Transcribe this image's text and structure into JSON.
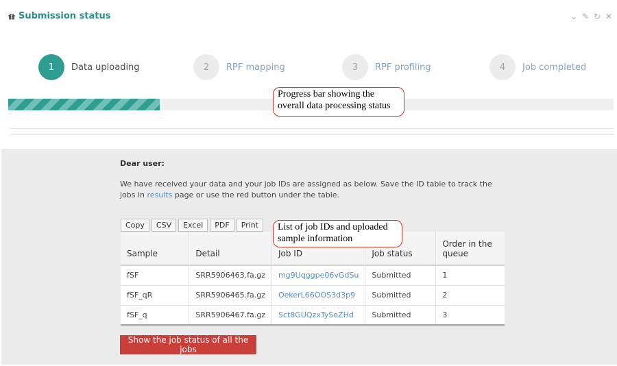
{
  "header": {
    "title": "Submission status",
    "icon": "gift-icon",
    "tools": [
      "chevron-down-icon",
      "wrench-icon",
      "refresh-icon",
      "close-icon"
    ],
    "tool_glyphs": [
      "⌄",
      "✎",
      "↻",
      "✕"
    ]
  },
  "steps": [
    {
      "number": "1",
      "label": "Data uploading",
      "active": true
    },
    {
      "number": "2",
      "label": "RPF mapping",
      "active": false
    },
    {
      "number": "3",
      "label": "RPF profiling",
      "active": false
    },
    {
      "number": "4",
      "label": "Job completed",
      "active": false
    }
  ],
  "progress": {
    "fraction": 0.25,
    "accent_color": "#2f9e92"
  },
  "annotations": {
    "progress_callout": "Progress bar showing the overall data processing status",
    "table_callout": "List of job IDs and uploaded sample information"
  },
  "main": {
    "greeting": "Dear user:",
    "message_before_link": "We have received your data and your job IDs are assigned as below. Save the ID table to track the jobs in ",
    "message_link": "results",
    "message_after_link": " page or use the red button under the table.",
    "export_buttons": [
      "Copy",
      "CSV",
      "Excel",
      "PDF",
      "Print"
    ],
    "table": {
      "headers": [
        "Sample",
        "Detail",
        "Job ID",
        "Job status",
        "Order in the queue"
      ],
      "rows": [
        [
          "fSF",
          "SRR5906463.fa.gz",
          "mg9Uqggpe06vGdSu",
          "Submitted",
          "1"
        ],
        [
          "fSF_qR",
          "SRR5906465.fa.gz",
          "OekerL66OOS3d3p9",
          "Submitted",
          "2"
        ],
        [
          "fSF_q",
          "SRR5906467.fa.gz",
          "Sct8GUQzxTySoZHd",
          "Submitted",
          "3"
        ]
      ]
    },
    "status_button": "Show the job status of all the jobs",
    "status_button_color": "#c9403a"
  }
}
